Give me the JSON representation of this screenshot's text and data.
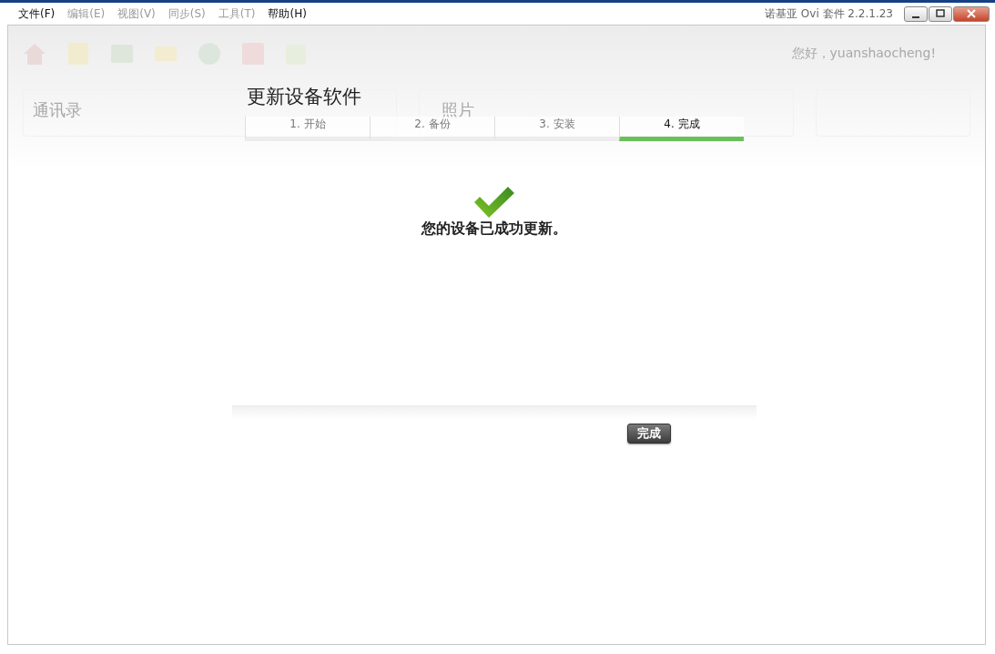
{
  "menu": [
    {
      "label": "文件(F)",
      "disabled": false
    },
    {
      "label": "编辑(E)",
      "disabled": true
    },
    {
      "label": "视图(V)",
      "disabled": true
    },
    {
      "label": "同步(S)",
      "disabled": true
    },
    {
      "label": "工具(T)",
      "disabled": true
    },
    {
      "label": "帮助(H)",
      "disabled": false
    }
  ],
  "window": {
    "title": "诺基亚 Ovi 套件 2.2.1.23"
  },
  "background": {
    "greeting": "您好，yuanshaocheng!",
    "panels": [
      {
        "title": "通讯录"
      },
      {
        "title": "照片"
      }
    ]
  },
  "dialog": {
    "title": "更新设备软件",
    "steps": [
      {
        "label": "1. 开始",
        "selected": false
      },
      {
        "label": "2. 备份",
        "selected": false
      },
      {
        "label": "3. 安装",
        "selected": false
      },
      {
        "label": "4. 完成",
        "selected": true
      }
    ],
    "message": "您的设备已成功更新。",
    "button": "完成"
  }
}
